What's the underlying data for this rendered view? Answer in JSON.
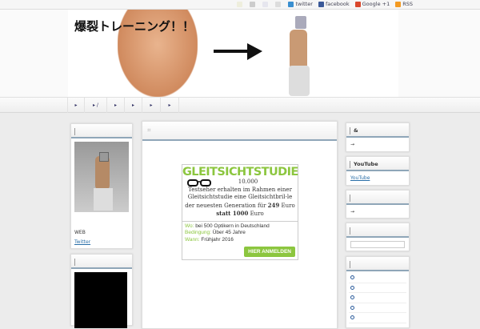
{
  "topbar": {
    "links": [
      {
        "label": "twitter",
        "color": "#3a8fd0"
      },
      {
        "label": "facebook",
        "color": "#3b5998"
      },
      {
        "label": "Google +1",
        "color": "#d9472b"
      },
      {
        "label": "RSS",
        "color": "#f39a22"
      }
    ]
  },
  "header": {
    "title": "爆裂トレーニング！！"
  },
  "nav": {
    "items": [
      "▸",
      "▸ /",
      "▸",
      "▸",
      "▸",
      "▸"
    ]
  },
  "left": {
    "profile_label": "WEB",
    "twitter_link": "Twitter"
  },
  "ad": {
    "title": "GLEITSICHTSTUDIE",
    "count": "10.000",
    "body1": "Testseher erhalten im Rahmen einer Gleitsichtstudie eine Gleitsichtbril-le der neuesten Generation für ",
    "price": "249",
    "body2": " Euro ",
    "statt": "statt 1000",
    "body3": " Euro",
    "where_label": "Wo:",
    "where": "bei 500 Optikern in Deutschland",
    "cond_label": "Bedingung:",
    "cond": "Über 45 Jahre",
    "when_label": "Wann:",
    "when": "Frühjahr 2016",
    "cta": "HIER ANMELDEN",
    "accent": "#8cc63f"
  },
  "right": {
    "w1_title": "&",
    "w1_arrow": "→",
    "w2_title": "YouTube",
    "w2_link": "YouTube",
    "w3_arrow": "→"
  }
}
